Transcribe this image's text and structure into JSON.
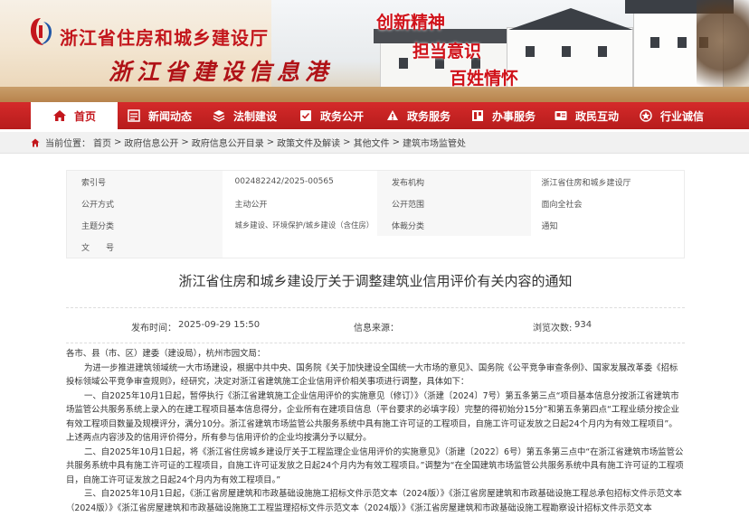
{
  "header": {
    "site_title": "浙江省住房和城乡建设厅",
    "slogan": "浙江省建设信息港",
    "mottos": [
      "创新精神",
      "担当意识",
      "百姓情怀"
    ]
  },
  "nav": {
    "items": [
      {
        "label": "首页",
        "icon": "home-icon"
      },
      {
        "label": "新闻动态",
        "icon": "news-icon"
      },
      {
        "label": "法制建设",
        "icon": "law-icon"
      },
      {
        "label": "政务公开",
        "icon": "disclosure-icon"
      },
      {
        "label": "政务服务",
        "icon": "service-icon"
      },
      {
        "label": "办事服务",
        "icon": "handling-icon"
      },
      {
        "label": "政民互动",
        "icon": "interaction-icon"
      },
      {
        "label": "行业诚信",
        "icon": "credit-icon"
      }
    ]
  },
  "breadcrumb": {
    "prefix": "当前位置：",
    "items": [
      "首页",
      "政府信息公开",
      "政府信息公开目录",
      "政策文件及解读",
      "其他文件",
      "建筑市场监管处"
    ],
    "sep": ">"
  },
  "info": {
    "index_label": "索引号",
    "index_value": "002482242/2025-00565",
    "org_label": "发布机构",
    "org_value": "浙江省住房和城乡建设厅",
    "open_mode_label": "公开方式",
    "open_mode_value": "主动公开",
    "scope_label": "公开范围",
    "scope_value": "面向全社会",
    "topic_label": "主题分类",
    "topic_value": "城乡建设、环境保护/城乡建设（含住房）",
    "genre_label": "体裁分类",
    "genre_value": "通知",
    "docno_label": "文　　号",
    "docno_value": ""
  },
  "document": {
    "title": "浙江省住房和城乡建设厅关于调整建筑业信用评价有关内容的通知",
    "publish_label": "发布时间：",
    "publish_time": "2025-09-29 15:50",
    "source_label": "信息来源：",
    "source_value": "",
    "views_label": "浏览次数:",
    "views": "934",
    "p0": "各市、县（市、区）建委（建设局），杭州市园文局：",
    "p1": "为进一步推进建筑领域统一大市场建设，根据中共中央、国务院《关于加快建设全国统一大市场的意见》、国务院《公平竞争审查条例》、国家发展改革委《招标投标领域公平竞争审查规则》，经研究，决定对浙江省建筑施工企业信用评价相关事项进行调整，具体如下：",
    "p2": "一、自2025年10月1日起，暂停执行《浙江省建筑施工企业信用评价的实施意见（修订）》（浙建〔2024〕7号）第五条第三点“项目基本信息分按浙江省建筑市场监管公共服务系统上录入的在建工程项目基本信息得分，企业所有在建项目信息（平台要求的必填字段）完整的得初始分15分”和第五条第四点“工程业绩分按企业有效工程项目数量及规模评分，满分10分。浙江省建筑市场监管公共服务系统中具有施工许可证的工程项目，自施工许可证发放之日起24个月内为有效工程项目”。上述两点内容涉及的信用评价得分，所有参与信用评价的企业均按满分予以赋分。",
    "p3": "二、自2025年10月1日起，将《浙江省住房城乡建设厅关于工程监理企业信用评价的实施意见》（浙建〔2022〕6号）第五条第三点中“在浙江省建筑市场监管公共服务系统中具有施工许可证的工程项目，自施工许可证发放之日起24个月内为有效工程项目。”调整为“在全国建筑市场监管公共服务系统中具有施工许可证的工程项目，自施工许可证发放之日起24个月内为有效工程项目。”",
    "p4": "三、自2025年10月1日起，《浙江省房屋建筑和市政基础设施施工招标文件示范文本（2024版）》《浙江省房屋建筑和市政基础设施工程总承包招标文件示范文本（2024版）》《浙江省房屋建筑和市政基础设施施工工程监理招标文件示范文本（2024版）》《浙江省房屋建筑和市政基础设施工程勘察设计招标文件示范文本"
  },
  "colors": {
    "brand_red": "#c3161c",
    "nav_red": "#c62020"
  }
}
